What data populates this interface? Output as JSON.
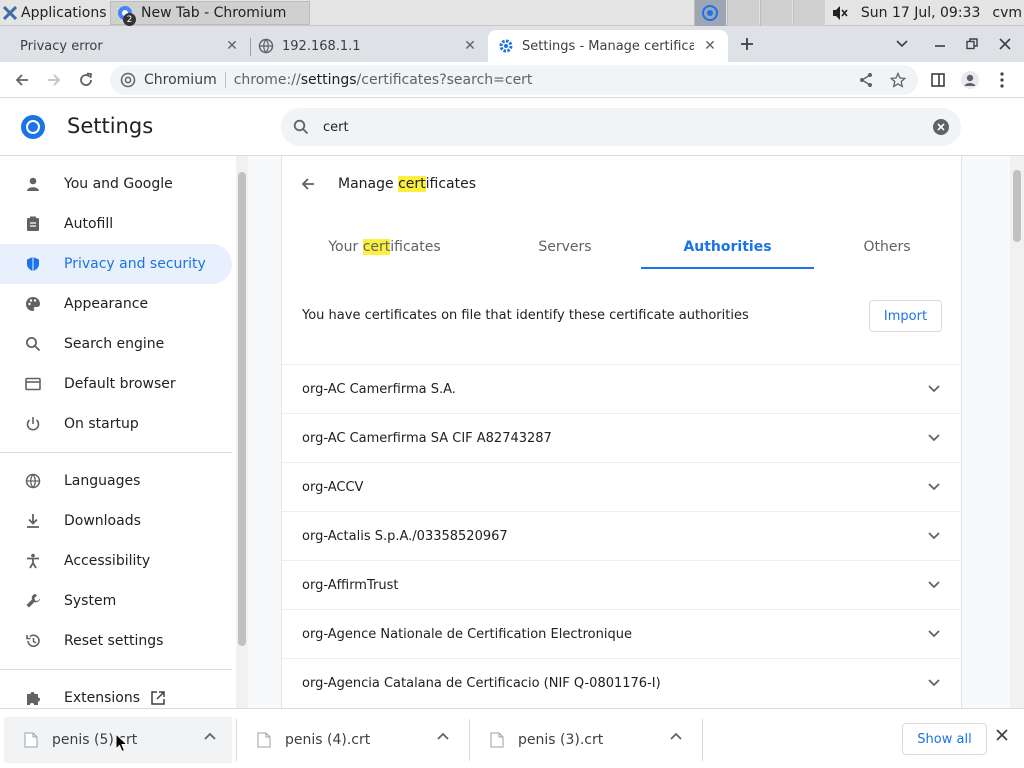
{
  "os_taskbar": {
    "apps_label": "Applications",
    "window_title": "New Tab - Chromium",
    "window_badge": "2",
    "clock": "Sun 17 Jul, 09:33",
    "user": "cvm"
  },
  "browser_tabs": [
    {
      "title": "Privacy error"
    },
    {
      "title": "192.168.1.1"
    },
    {
      "title": "Settings - Manage certificates"
    }
  ],
  "omnibox": {
    "chip": "Chromium",
    "url_prefix": "chrome://",
    "url_host": "settings",
    "url_path": "/certificates?search=cert"
  },
  "settings": {
    "title": "Settings",
    "search_value": "cert"
  },
  "sidebar": {
    "items": [
      {
        "label": "You and Google",
        "icon": "person-icon"
      },
      {
        "label": "Autofill",
        "icon": "clipboard-icon"
      },
      {
        "label": "Privacy and security",
        "icon": "shield-icon",
        "active": true
      },
      {
        "label": "Appearance",
        "icon": "palette-icon"
      },
      {
        "label": "Search engine",
        "icon": "search-icon"
      },
      {
        "label": "Default browser",
        "icon": "browser-icon"
      },
      {
        "label": "On startup",
        "icon": "power-icon"
      },
      {
        "label": "Languages",
        "icon": "globe-icon"
      },
      {
        "label": "Downloads",
        "icon": "download-icon"
      },
      {
        "label": "Accessibility",
        "icon": "accessibility-icon"
      },
      {
        "label": "System",
        "icon": "wrench-icon"
      },
      {
        "label": "Reset settings",
        "icon": "history-icon"
      },
      {
        "label": "Extensions",
        "icon": "puzzle-icon"
      }
    ]
  },
  "card": {
    "title_pre": "Manage ",
    "title_highlight": "cert",
    "title_post": "ificates",
    "tabs": {
      "yours_highlight": "cert",
      "yours_pre": "Your ",
      "yours_post": "ificates",
      "servers": "Servers",
      "authorities": "Authorities",
      "others": "Others"
    },
    "description": "You have certificates on file that identify these certificate authorities",
    "import_label": "Import",
    "certificates": [
      "org-AC Camerfirma S.A.",
      "org-AC Camerfirma SA CIF A82743287",
      "org-ACCV",
      "org-Actalis S.p.A./03358520967",
      "org-AffirmTrust",
      "org-Agence Nationale de Certification Electronique",
      "org-Agencia Catalana de Certificacio (NIF Q-0801176-I)"
    ]
  },
  "downloads": {
    "items": [
      "penis (5).crt",
      "penis (4).crt",
      "penis (3).crt"
    ],
    "show_all": "Show all"
  },
  "colors": {
    "accent": "#1a73e8",
    "highlight": "#fdef3c",
    "active_nav_bg": "#e8f0fe"
  }
}
